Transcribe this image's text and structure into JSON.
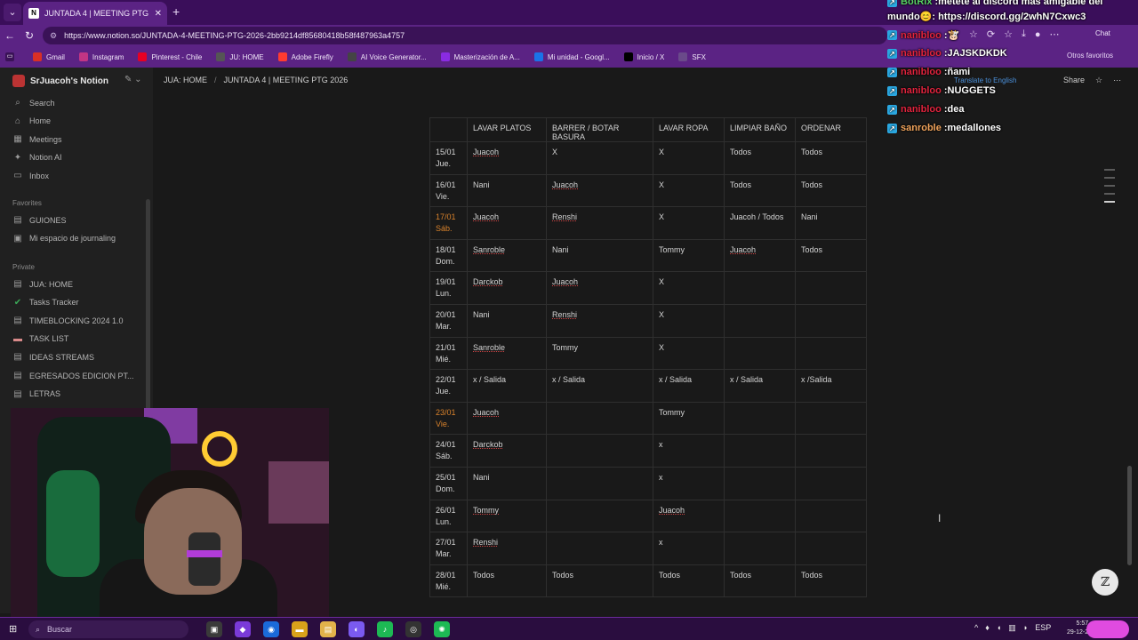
{
  "browser": {
    "tab_title": "JUNTADA 4 | MEETING PTG 2026",
    "url": "https://www.notion.so/JUNTADA-4-MEETING-PTG-2026-2bb9214df85680418b58f487963a4757",
    "chat_label": "Chat",
    "bookmarks": [
      {
        "label": "Gmail",
        "icon": "gmail-icon",
        "color": "#d93025"
      },
      {
        "label": "Instagram",
        "icon": "instagram-icon",
        "color": "#c13584"
      },
      {
        "label": "Pinterest - Chile",
        "icon": "pinterest-icon",
        "color": "#e60023"
      },
      {
        "label": "JU: HOME",
        "icon": "notion-icon",
        "color": "#555555"
      },
      {
        "label": "Adobe Firefly",
        "icon": "firefly-icon",
        "color": "#ff3b30"
      },
      {
        "label": "AI Voice Generator...",
        "icon": "elevenlabs-icon",
        "color": "#444444"
      },
      {
        "label": "Masterización de A...",
        "icon": "mastering-icon",
        "color": "#8a2be2"
      },
      {
        "label": "Mi unidad - Googl...",
        "icon": "drive-icon",
        "color": "#1a73e8"
      },
      {
        "label": "Inicio / X",
        "icon": "x-icon",
        "color": "#000000"
      },
      {
        "label": "SFX",
        "icon": "folder-icon",
        "color": "#6a4a8a"
      }
    ],
    "other_bookmarks": "Otros favoritos"
  },
  "sidebar": {
    "workspace": "SrJuacoh's Notion",
    "top_items": [
      {
        "label": "Search",
        "icon": "search-icon"
      },
      {
        "label": "Home",
        "icon": "home-icon"
      },
      {
        "label": "Meetings",
        "icon": "meetings-icon"
      },
      {
        "label": "Notion AI",
        "icon": "notion-ai-icon"
      },
      {
        "label": "Inbox",
        "icon": "inbox-icon"
      }
    ],
    "favorites_heading": "Favorites",
    "favorites": [
      {
        "label": "GUIONES",
        "icon": "page-icon"
      },
      {
        "label": "Mi espacio de journaling",
        "icon": "journal-icon"
      }
    ],
    "private_heading": "Private",
    "private": [
      {
        "label": "JUA: HOME",
        "icon": "page-icon"
      },
      {
        "label": "Tasks Tracker",
        "icon": "check-circle-icon"
      },
      {
        "label": "TIMEBLOCKING 2024 1.0",
        "icon": "page-icon"
      },
      {
        "label": "TASK LIST",
        "icon": "cover-icon"
      },
      {
        "label": "IDEAS STREAMS",
        "icon": "page-icon"
      },
      {
        "label": "EGRESADOS EDICION PT...",
        "icon": "page-icon"
      },
      {
        "label": "LETRAS",
        "icon": "page-icon"
      }
    ]
  },
  "topbar": {
    "breadcrumb": [
      "JUA: HOME",
      "JUNTADA 4 | MEETING PTG 2026"
    ],
    "share": "Share",
    "translate": "Translate to English"
  },
  "table": {
    "headers": [
      "",
      "LAVAR PLATOS",
      "BARRER / BOTAR BASURA",
      "LAVAR ROPA",
      "LIMPIAR BAÑO",
      "ORDENAR"
    ],
    "rows": [
      {
        "date": "15/01",
        "day": "Jue.",
        "weekend": false,
        "cells": [
          "Juacoh",
          "X",
          "X",
          "Todos",
          "Todos"
        ]
      },
      {
        "date": "16/01",
        "day": "Vie.",
        "weekend": false,
        "cells": [
          "Nani",
          "Juacoh",
          "X",
          "Todos",
          "Todos"
        ]
      },
      {
        "date": "17/01",
        "day": "Sáb.",
        "weekend": true,
        "cells": [
          "Juacoh",
          "Renshi",
          "X",
          "Juacoh / Todos",
          "Nani"
        ]
      },
      {
        "date": "18/01",
        "day": "Dom.",
        "weekend": false,
        "cells": [
          "Sanroble",
          "Nani",
          "Tommy",
          "Juacoh",
          "Todos"
        ]
      },
      {
        "date": "19/01",
        "day": "Lun.",
        "weekend": false,
        "cells": [
          "Darckob",
          "Juacoh",
          "X",
          "",
          ""
        ]
      },
      {
        "date": "20/01",
        "day": "Mar.",
        "weekend": false,
        "cells": [
          "Nani",
          "Renshi",
          "X",
          "",
          ""
        ]
      },
      {
        "date": "21/01",
        "day": "Mié.",
        "weekend": false,
        "cells": [
          "Sanroble",
          "Tommy",
          "X",
          "",
          ""
        ]
      },
      {
        "date": "22/01",
        "day": "Jue.",
        "weekend": false,
        "cells": [
          "x / Salida",
          "x / Salida",
          "x / Salida",
          "x / Salida",
          "x /Salida"
        ]
      },
      {
        "date": "23/01",
        "day": "Vie.",
        "weekend": true,
        "cells": [
          "Juacoh",
          "",
          "Tommy",
          "",
          ""
        ]
      },
      {
        "date": "24/01",
        "day": "Sáb.",
        "weekend": false,
        "cells": [
          "Darckob",
          "",
          "x",
          "",
          ""
        ]
      },
      {
        "date": "25/01",
        "day": "Dom.",
        "weekend": false,
        "cells": [
          "Nani",
          "",
          "x",
          "",
          ""
        ]
      },
      {
        "date": "26/01",
        "day": "Lun.",
        "weekend": false,
        "cells": [
          "Tommy",
          "",
          "Juacoh",
          "",
          ""
        ]
      },
      {
        "date": "27/01",
        "day": "Mar.",
        "weekend": false,
        "cells": [
          "Renshi",
          "",
          "x",
          "",
          ""
        ]
      },
      {
        "date": "28/01",
        "day": "Mié.",
        "weekend": false,
        "cells": [
          "Todos",
          "Todos",
          "Todos",
          "Todos",
          "Todos"
        ]
      }
    ]
  },
  "chat": [
    {
      "user": "BotRix",
      "msg": "metete al discord mas amigable del",
      "user_color": "#58d364"
    },
    {
      "user": "",
      "msg": "mundo😊: https://discord.gg/2whN7Cxwc3",
      "user_color": "#ffffff"
    },
    {
      "user": "nanibloo",
      "msg": "🐮",
      "user_color": "#e0233d"
    },
    {
      "user": "nanibloo",
      "msg": "JAJSKDKDK",
      "user_color": "#e0233d"
    },
    {
      "user": "nanibloo",
      "msg": "ñami",
      "user_color": "#e0233d"
    },
    {
      "user": "nanibloo",
      "msg": "NUGGETS",
      "user_color": "#e0233d"
    },
    {
      "user": "nanibloo",
      "msg": "dea",
      "user_color": "#e0233d"
    },
    {
      "user": "sanroble",
      "msg": "medallones",
      "user_color": "#f0a35b"
    }
  ],
  "taskbar": {
    "search": "Buscar",
    "lang": "ESP",
    "time": "5:57",
    "date": "29-12-2"
  },
  "colors": {
    "browser_purple": "#5b2384",
    "notion_bg": "#191919",
    "weekend_date": "#d9822b"
  }
}
